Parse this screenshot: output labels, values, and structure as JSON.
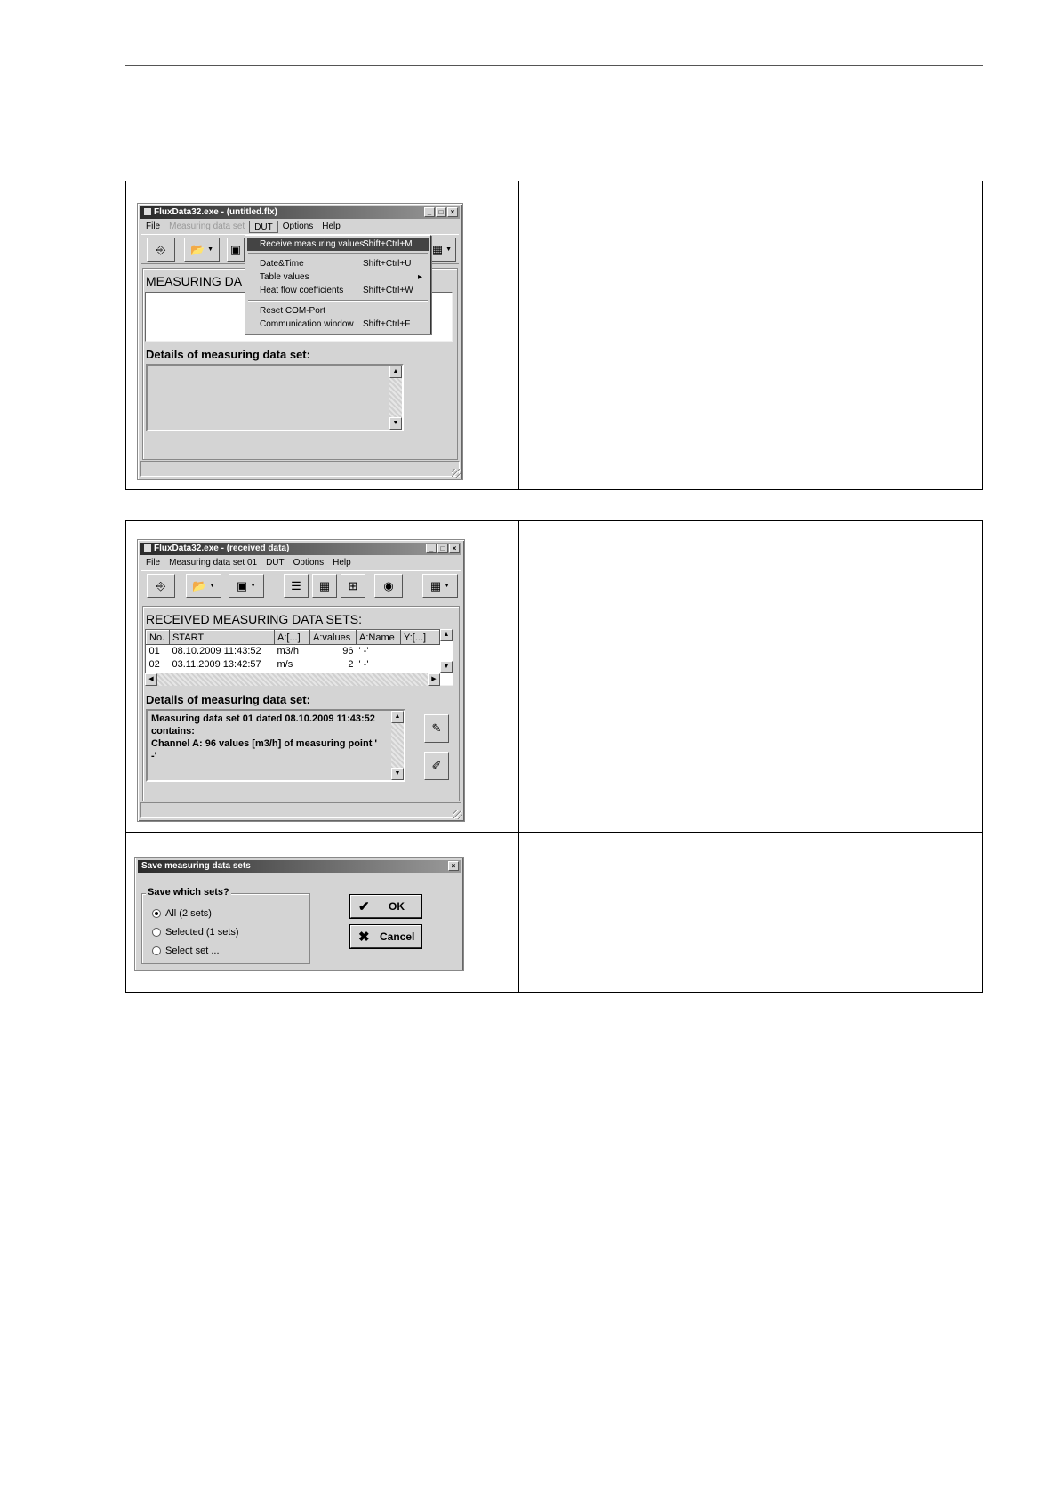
{
  "panel1": {
    "window": {
      "title": "FluxData32.exe - (untitled.flx)",
      "menu": [
        "File",
        "Measuring data set",
        "DUT",
        "Options",
        "Help"
      ],
      "dropdown": [
        {
          "label": "Receive measuring values",
          "shortcut": "Shift+Ctrl+M"
        },
        {
          "label": "Date&Time",
          "shortcut": "Shift+Ctrl+U"
        },
        {
          "label": "Table values",
          "shortcut": "▸"
        },
        {
          "label": "Heat flow coefficients",
          "shortcut": "Shift+Ctrl+W"
        },
        {
          "label": "Reset COM-Port",
          "shortcut": ""
        },
        {
          "label": "Communication window",
          "shortcut": "Shift+Ctrl+F"
        }
      ],
      "list_heading": "MEASURING DA",
      "details_label": "Details of measuring data set:"
    }
  },
  "panel2": {
    "window": {
      "title": "FluxData32.exe - (received data)",
      "menu": [
        "File",
        "Measuring data set 01",
        "DUT",
        "Options",
        "Help"
      ],
      "list_heading": "RECEIVED MEASURING DATA SETS:",
      "columns": [
        "No.",
        "START",
        "A:[...]",
        "A:values",
        "A:Name",
        "Y:[...]"
      ],
      "rows": [
        [
          "01",
          "08.10.2009   11:43:52",
          "m3/h",
          "96",
          "'       -'",
          ""
        ],
        [
          "02",
          "03.11.2009   13:42:57",
          "m/s",
          "2",
          "'       -'",
          ""
        ]
      ],
      "details_label": "Details of measuring data set:",
      "details_text": {
        "line1": "Measuring data set 01 dated 08.10.2009   11:43:52",
        "line2": "contains:",
        "line3": "Channel A:   96 values [m3/h] of  measuring point '",
        "line4": "     -'"
      }
    }
  },
  "panel3": {
    "dialog": {
      "title": "Save measuring data sets",
      "group_label": "Save which sets?",
      "options": [
        "All (2 sets)",
        "Selected (1 sets)",
        "Select set ..."
      ],
      "selected_index": 0,
      "ok_label": "OK",
      "cancel_label": "Cancel"
    }
  }
}
